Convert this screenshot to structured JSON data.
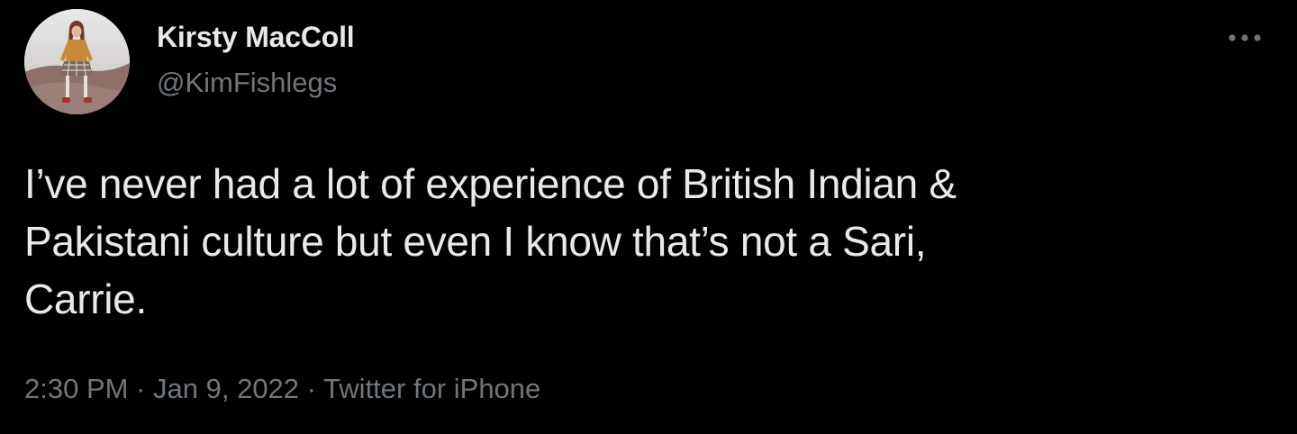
{
  "tweet": {
    "author": {
      "display_name": "Kirsty MacColl",
      "handle": "@KimFishlegs"
    },
    "more_icon": "more-horizontal-icon",
    "text": "I’ve never had a lot of experience of British Indian &\nPakistani culture but even I know that’s not a Sari,\nCarrie.",
    "time": "2:30 PM",
    "separator": "·",
    "date": "Jan 9, 2022",
    "source": "Twitter for iPhone"
  },
  "colors": {
    "background": "#000000",
    "primary_text": "#e7e9ea",
    "secondary_text": "#71767b"
  }
}
